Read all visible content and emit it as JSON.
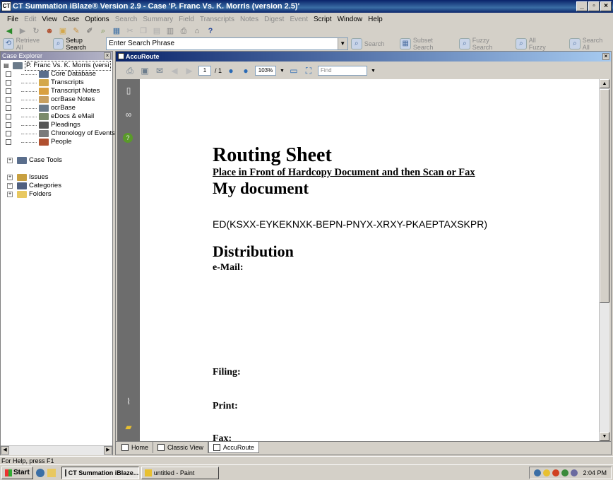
{
  "window": {
    "title": "CT Summation iBlaze® Version 2.9 - Case 'P. Franc Vs. K. Morris (version 2.5)'"
  },
  "menu": [
    {
      "label": "File",
      "enabled": true
    },
    {
      "label": "Edit",
      "enabled": false
    },
    {
      "label": "View",
      "enabled": true
    },
    {
      "label": "Case",
      "enabled": true
    },
    {
      "label": "Options",
      "enabled": true
    },
    {
      "label": "Search",
      "enabled": false
    },
    {
      "label": "Summary",
      "enabled": false
    },
    {
      "label": "Field",
      "enabled": false
    },
    {
      "label": "Transcripts",
      "enabled": false
    },
    {
      "label": "Notes",
      "enabled": false
    },
    {
      "label": "Digest",
      "enabled": false
    },
    {
      "label": "Event",
      "enabled": false
    },
    {
      "label": "Script",
      "enabled": true
    },
    {
      "label": "Window",
      "enabled": true
    },
    {
      "label": "Help",
      "enabled": true
    }
  ],
  "search_toolbar": {
    "retrieve_all": "Retrieve All",
    "setup_search": "Setup Search",
    "search_placeholder": "Enter Search Phrase",
    "search": "Search",
    "subset_search": "Subset Search",
    "fuzzy_search": "Fuzzy Search",
    "all_fuzzy": "All Fuzzy",
    "search_all": "Search All"
  },
  "explorer": {
    "title": "Case Explorer",
    "case_name": "P. Franc Vs. K. Morris (versi",
    "items": [
      {
        "label": "Core Database",
        "color": "#5a6e8c"
      },
      {
        "label": "Transcripts",
        "color": "#d4a84a"
      },
      {
        "label": "Transcript Notes",
        "color": "#d9a040"
      },
      {
        "label": "ocrBase Notes",
        "color": "#c8a060"
      },
      {
        "label": "ocrBase",
        "color": "#6a7a8a"
      },
      {
        "label": "eDocs & eMail",
        "color": "#7a8a6a"
      },
      {
        "label": "Pleadings",
        "color": "#555555"
      },
      {
        "label": "Chronology of Events",
        "color": "#7a7a7a"
      },
      {
        "label": "People",
        "color": "#b05030"
      }
    ],
    "case_tools": "Case Tools",
    "sections": [
      {
        "label": "Issues",
        "color": "#c8a040"
      },
      {
        "label": "Categories",
        "color": "#506080"
      },
      {
        "label": "Folders",
        "color": "#e8c860"
      }
    ]
  },
  "viewer": {
    "title": "AccuRoute",
    "page_current": "1",
    "page_total": "/ 1",
    "zoom": "103%",
    "find_placeholder": "Find"
  },
  "document": {
    "heading": "Routing Sheet",
    "subheading": "Place in Front of Hardcopy Document and then Scan or Fax",
    "doc_title": "My document",
    "code": "ED(KSXX-EYKEKNXK-BEPN-PNYX-XRXY-PKAEPTAXSKPR)",
    "distribution": "Distribution",
    "email_label": "e-Mail:",
    "filing_label": "Filing:",
    "print_label": "Print:",
    "fax_label": "Fax:"
  },
  "doc_tabs": [
    {
      "label": "Home",
      "active": false
    },
    {
      "label": "Classic View",
      "active": false
    },
    {
      "label": "AccuRoute",
      "active": true
    }
  ],
  "status": {
    "help_text": "For Help, press F1"
  },
  "taskbar": {
    "start": "Start",
    "tasks": [
      {
        "label": "CT Summation iBlaze...",
        "active": true
      },
      {
        "label": "untitled - Paint",
        "active": false
      }
    ],
    "clock": "2:04 PM"
  }
}
